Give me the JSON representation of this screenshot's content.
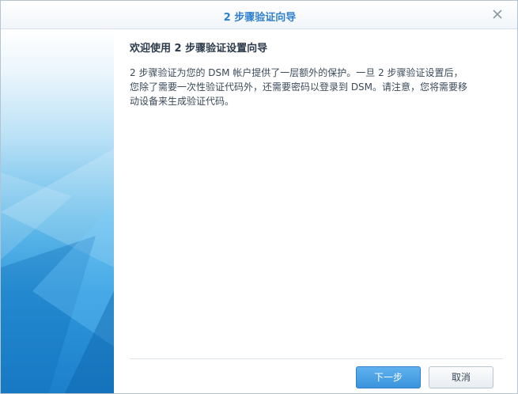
{
  "dialog": {
    "title": "2 步骤验证向导",
    "close_icon": "close-icon"
  },
  "content": {
    "heading": "欢迎使用 2 步骤验证设置向导",
    "description_lines": [
      "2 步骤验证为您的 DSM 帐户提供了一层额外的保护。一旦 2 步骤验证设置后，",
      "您除了需要一次性验证代码外，还需要密码以登录到 DSM。请注意，您将需要移",
      "动设备来生成验证代码。"
    ]
  },
  "buttons": {
    "next_label": "下一步",
    "cancel_label": "取消"
  },
  "colors": {
    "title_accent": "#2f7fcd",
    "primary_button": "#3a93dc",
    "sidebar_blue": "#1c7fca"
  }
}
